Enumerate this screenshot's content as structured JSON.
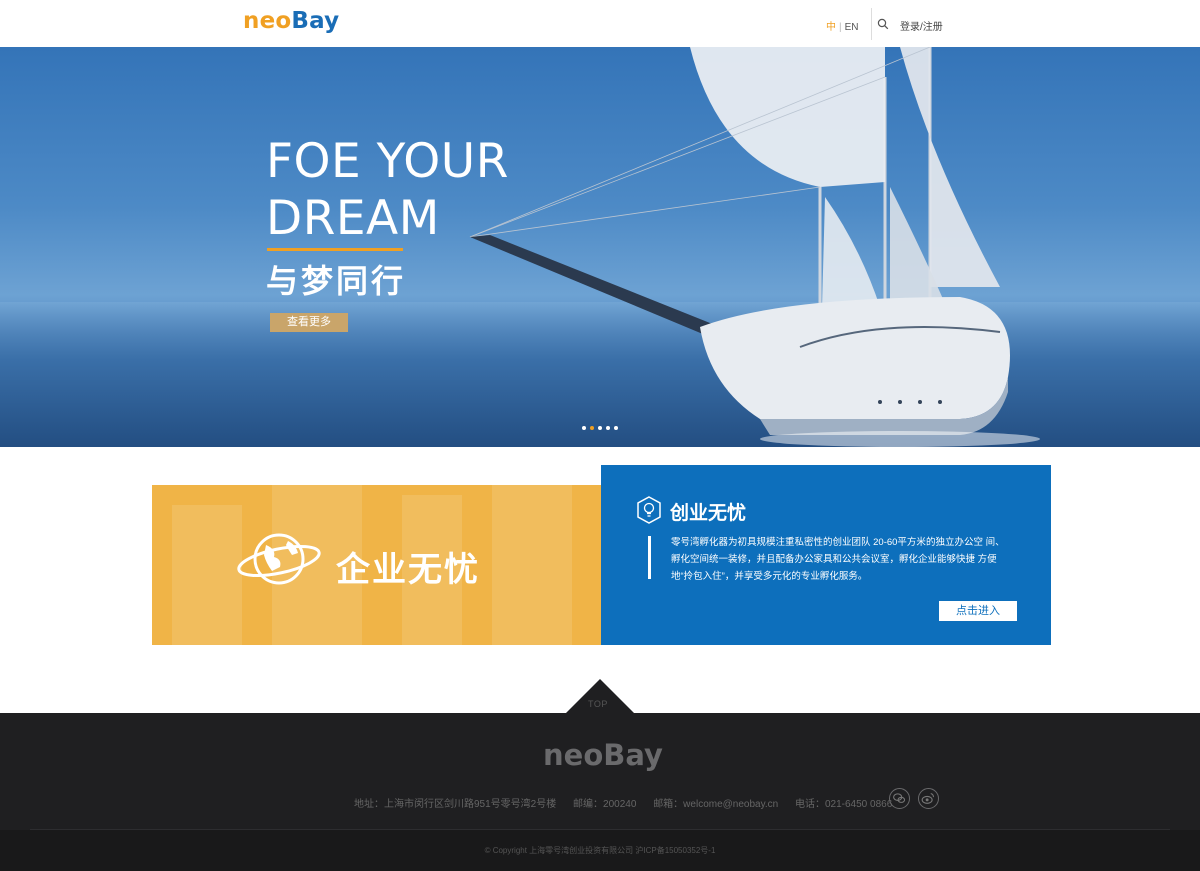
{
  "header": {
    "logo_part1": "neo",
    "logo_part2": "Bay",
    "lang_zh": "中",
    "lang_sep": "|",
    "lang_en": "EN",
    "search_icon": "search-icon",
    "login_label": "登录/注册"
  },
  "banner": {
    "title_line1": "FOE YOUR",
    "title_line2": "DREAM",
    "subtitle": "与梦同行",
    "button_label": "查看更多",
    "carousel_dots": 5,
    "active_dot": 2,
    "colors": {
      "accent": "#f0a023",
      "button": "#c9a56a"
    }
  },
  "feature": {
    "left_title": "企业无忧",
    "left_icon": "globe-icon",
    "right_icon": "bulb-icon",
    "right_title": "创业无忧",
    "description": "零号湾孵化器为初具规模注重私密性的创业团队 20-60平方米的独立办公空 间、孵化空间统一装修，并且配备办公家具和公共会议室，孵化企业能够快捷 方便地“拎包入住”，并享受多元化的专业孵化服务。",
    "button_label": "点击进入",
    "colors": {
      "left_bg": "#f0b447",
      "right_bg": "#0d6fbc"
    }
  },
  "footer": {
    "top_label": "TOP",
    "logo": "neoBay",
    "address": "地址：上海市闵行区剑川路951号零号湾2号楼",
    "postcode": "邮编：200240",
    "email": "邮箱：welcome@neobay.cn",
    "phone": "电话：021-6450 0866",
    "social_icons": [
      "wechat-icon",
      "weibo-icon"
    ],
    "copyright": "© Copyright 上海零号湾创业投资有限公司 沪ICP备15050352号-1"
  }
}
